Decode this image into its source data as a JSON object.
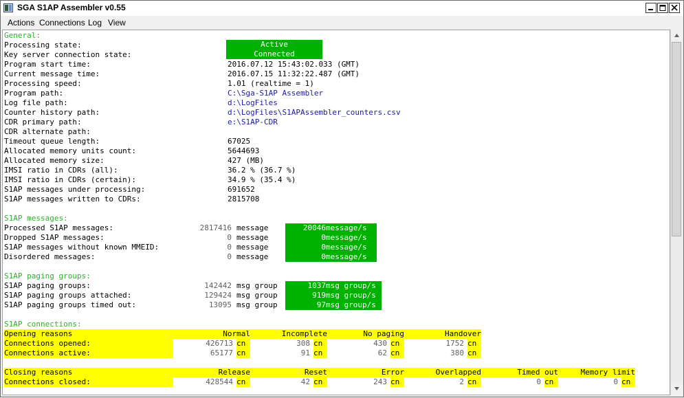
{
  "window": {
    "title": "SGA S1AP Assembler v0.55"
  },
  "menu": [
    "Actions",
    "Connections",
    "Log",
    "View"
  ],
  "general": {
    "header": "General:",
    "processing_state": {
      "label": "Processing state:",
      "value": "Active"
    },
    "key_server_state": {
      "label": "Key server connection state:",
      "value": "Connected"
    },
    "rows": [
      {
        "label": "Program start time:",
        "value": "2016.07.12 15:43:02.033 (GMT)",
        "link": false
      },
      {
        "label": "Current message time:",
        "value": "2016.07.15 11:32:22.487 (GMT)",
        "link": false
      },
      {
        "label": "Processing speed:",
        "value": "1.01 (realtime = 1)",
        "link": false
      },
      {
        "label": "Program path:",
        "value": "C:\\Sga-S1AP Assembler",
        "link": true
      },
      {
        "label": "Log file path:",
        "value": "d:\\LogFiles",
        "link": true
      },
      {
        "label": "Counter history path:",
        "value": "d:\\LogFiles\\S1APAssembler_counters.csv",
        "link": true
      },
      {
        "label": "CDR primary path:",
        "value": "e:\\S1AP-CDR",
        "link": true
      },
      {
        "label": "CDR alternate path:",
        "value": "",
        "link": false
      },
      {
        "label": "Timeout queue length:",
        "value": "67025",
        "link": false
      },
      {
        "label": "Allocated memory units count:",
        "value": "5644693",
        "link": false
      },
      {
        "label": "Allocated memory size:",
        "value": "427 (MB)",
        "link": false
      },
      {
        "label": "IMSI ratio in CDRs (all):",
        "value": "36.2 % (36.7 %)",
        "link": false
      },
      {
        "label": "IMSI ratio in CDRs (certain):",
        "value": "34.9 % (35.4 %)",
        "link": false
      },
      {
        "label": "S1AP messages under processing:",
        "value": "691652",
        "link": false
      },
      {
        "label": "S1AP messages written to CDRs:",
        "value": "2815708",
        "link": false
      }
    ]
  },
  "s1ap_messages": {
    "header": "S1AP messages:",
    "rows": [
      {
        "label": "Processed S1AP messages:",
        "count": "2817416",
        "unit": "message",
        "rate": "20046",
        "rate_unit": "message/s"
      },
      {
        "label": "Dropped S1AP messages:",
        "count": "0",
        "unit": "message",
        "rate": "0",
        "rate_unit": "message/s"
      },
      {
        "label": "S1AP messages without known MMEID:",
        "count": "0",
        "unit": "message",
        "rate": "0",
        "rate_unit": "message/s"
      },
      {
        "label": "Disordered messages:",
        "count": "0",
        "unit": "message",
        "rate": "0",
        "rate_unit": "message/s"
      }
    ]
  },
  "paging": {
    "header": "S1AP paging groups:",
    "rows": [
      {
        "label": "S1AP paging groups:",
        "count": "142442",
        "unit": "msg group",
        "rate": "1037",
        "rate_unit": "msg group/s"
      },
      {
        "label": "S1AP paging groups attached:",
        "count": "129424",
        "unit": "msg group",
        "rate": "919",
        "rate_unit": "msg group/s"
      },
      {
        "label": "S1AP paging groups timed out:",
        "count": "13095",
        "unit": "msg group",
        "rate": "97",
        "rate_unit": "msg group/s"
      }
    ]
  },
  "connections": {
    "header": "S1AP connections:",
    "unit": "cn",
    "opening": {
      "title": "Opening reasons",
      "columns": [
        "Normal",
        "Incomplete",
        "No paging",
        "Handover"
      ],
      "rows": [
        {
          "label": "Connections opened:",
          "values": [
            "426713",
            "308",
            "430",
            "1752"
          ]
        },
        {
          "label": "Connections active:",
          "values": [
            "65177",
            "91",
            "62",
            "380"
          ]
        }
      ]
    },
    "closing": {
      "title": "Closing reasons",
      "columns": [
        "Release",
        "Reset",
        "Error",
        "Overlapped",
        "Timed out",
        "Memory limit"
      ],
      "rows": [
        {
          "label": "Connections closed:",
          "values": [
            "428544",
            "42",
            "243",
            "2",
            "0",
            "0"
          ]
        }
      ]
    }
  },
  "colors": {
    "accent_green": "#00b200",
    "header_green": "#2db02d",
    "highlight_yellow": "#ffff00",
    "path_blue": "#1a1aa0"
  }
}
